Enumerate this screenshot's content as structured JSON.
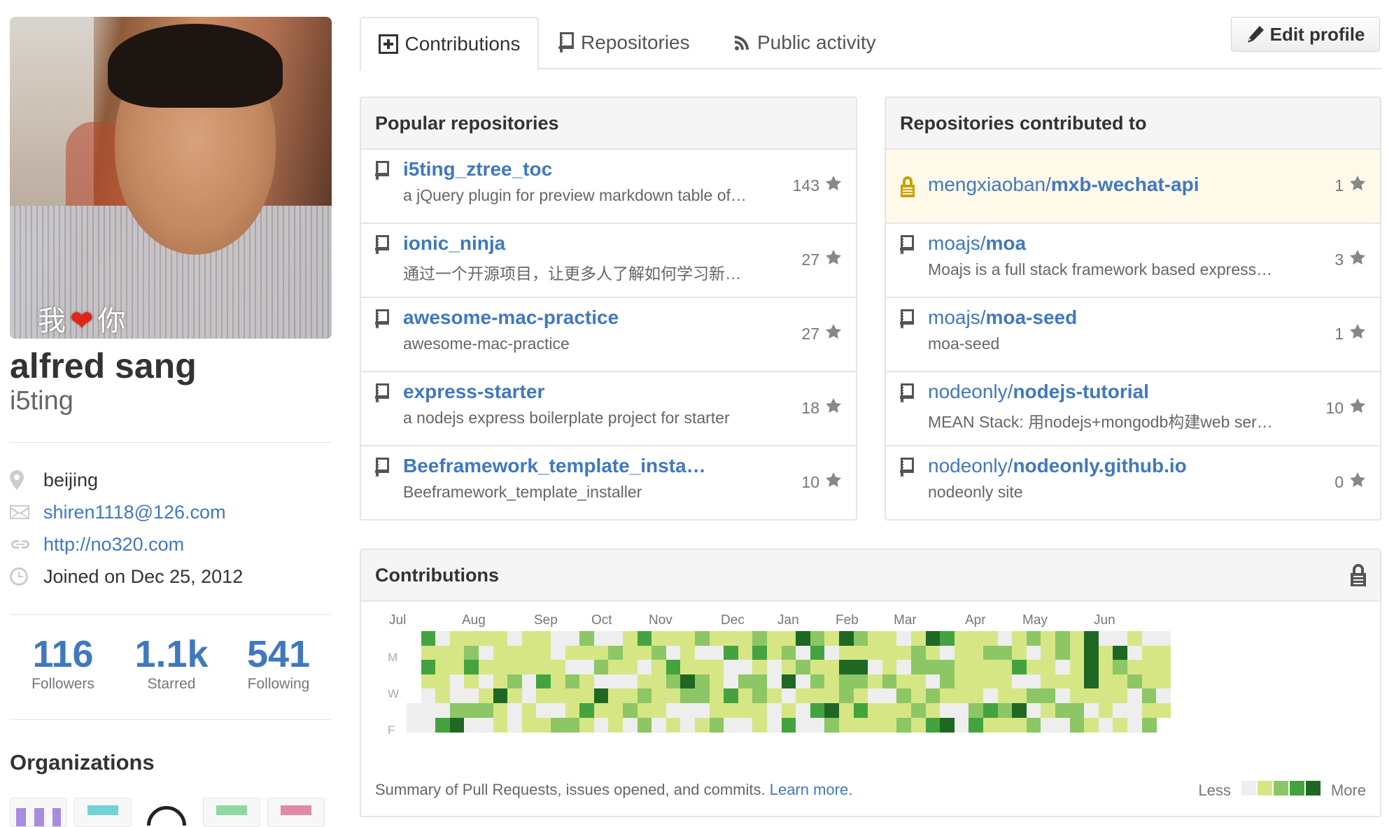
{
  "profile": {
    "avatar_caption_left": "我",
    "avatar_caption_right": "你",
    "full_name": "alfred sang",
    "username": "i5ting",
    "location": "beijing",
    "email": "shiren1118@126.com",
    "website": "http://no320.com",
    "joined": "Joined on Dec 25, 2012"
  },
  "stats": [
    {
      "num": "116",
      "label": "Followers"
    },
    {
      "num": "1.1k",
      "label": "Starred"
    },
    {
      "num": "541",
      "label": "Following"
    }
  ],
  "organizations": {
    "heading": "Organizations",
    "logo_colors": [
      "#a98be0",
      "#6fd3d8",
      "#222222",
      "#8fd8a0",
      "#e08aa8"
    ]
  },
  "tabs": [
    {
      "label": "Contributions",
      "icon": "plus-square-icon"
    },
    {
      "label": "Repositories",
      "icon": "repo-book-icon"
    },
    {
      "label": "Public activity",
      "icon": "rss-icon"
    }
  ],
  "edit_profile_label": "Edit profile",
  "popular": {
    "title": "Popular repositories",
    "items": [
      {
        "name": "i5ting_ztree_toc",
        "desc": "a jQuery plugin for preview markdown table of…",
        "stars": "143"
      },
      {
        "name": "ionic_ninja",
        "desc": "通过一个开源项目，让更多人了解如何学习新…",
        "stars": "27"
      },
      {
        "name": "awesome-mac-practice",
        "desc": "awesome-mac-practice",
        "stars": "27"
      },
      {
        "name": "express-starter",
        "desc": "a nodejs express boilerplate project for starter",
        "stars": "18"
      },
      {
        "name": "Beeframework_template_insta…",
        "desc": "Beeframework_template_installer",
        "stars": "10"
      }
    ]
  },
  "contributed": {
    "title": "Repositories contributed to",
    "items": [
      {
        "owner": "mengxiaoban/",
        "repo": "mxb-wechat-api",
        "desc": "",
        "stars": "1",
        "private": true
      },
      {
        "owner": "moajs/",
        "repo": "moa",
        "desc": "Moajs is a full stack framework based express…",
        "stars": "3"
      },
      {
        "owner": "moajs/",
        "repo": "moa-seed",
        "desc": "moa-seed",
        "stars": "1"
      },
      {
        "owner": "nodeonly/",
        "repo": "nodejs-tutorial",
        "desc": "MEAN Stack: 用nodejs+mongodb构建web ser…",
        "stars": "10"
      },
      {
        "owner": "nodeonly/",
        "repo": "nodeonly.github.io",
        "desc": "nodeonly site",
        "stars": "0"
      }
    ]
  },
  "contributions": {
    "title": "Contributions",
    "months": [
      "Jul",
      "Aug",
      "Sep",
      "Oct",
      "Nov",
      "Dec",
      "Jan",
      "Feb",
      "Mar",
      "Apr",
      "May",
      "Jun"
    ],
    "days": [
      "M",
      "W",
      "F"
    ],
    "summary": "Summary of Pull Requests, issues opened, and commits.",
    "learn_more": "Learn more.",
    "legend_less": "Less",
    "legend_more": "More",
    "colors": [
      "#eeeeee",
      "#d6e685",
      "#8cc665",
      "#44a340",
      "#1e6823"
    ]
  }
}
